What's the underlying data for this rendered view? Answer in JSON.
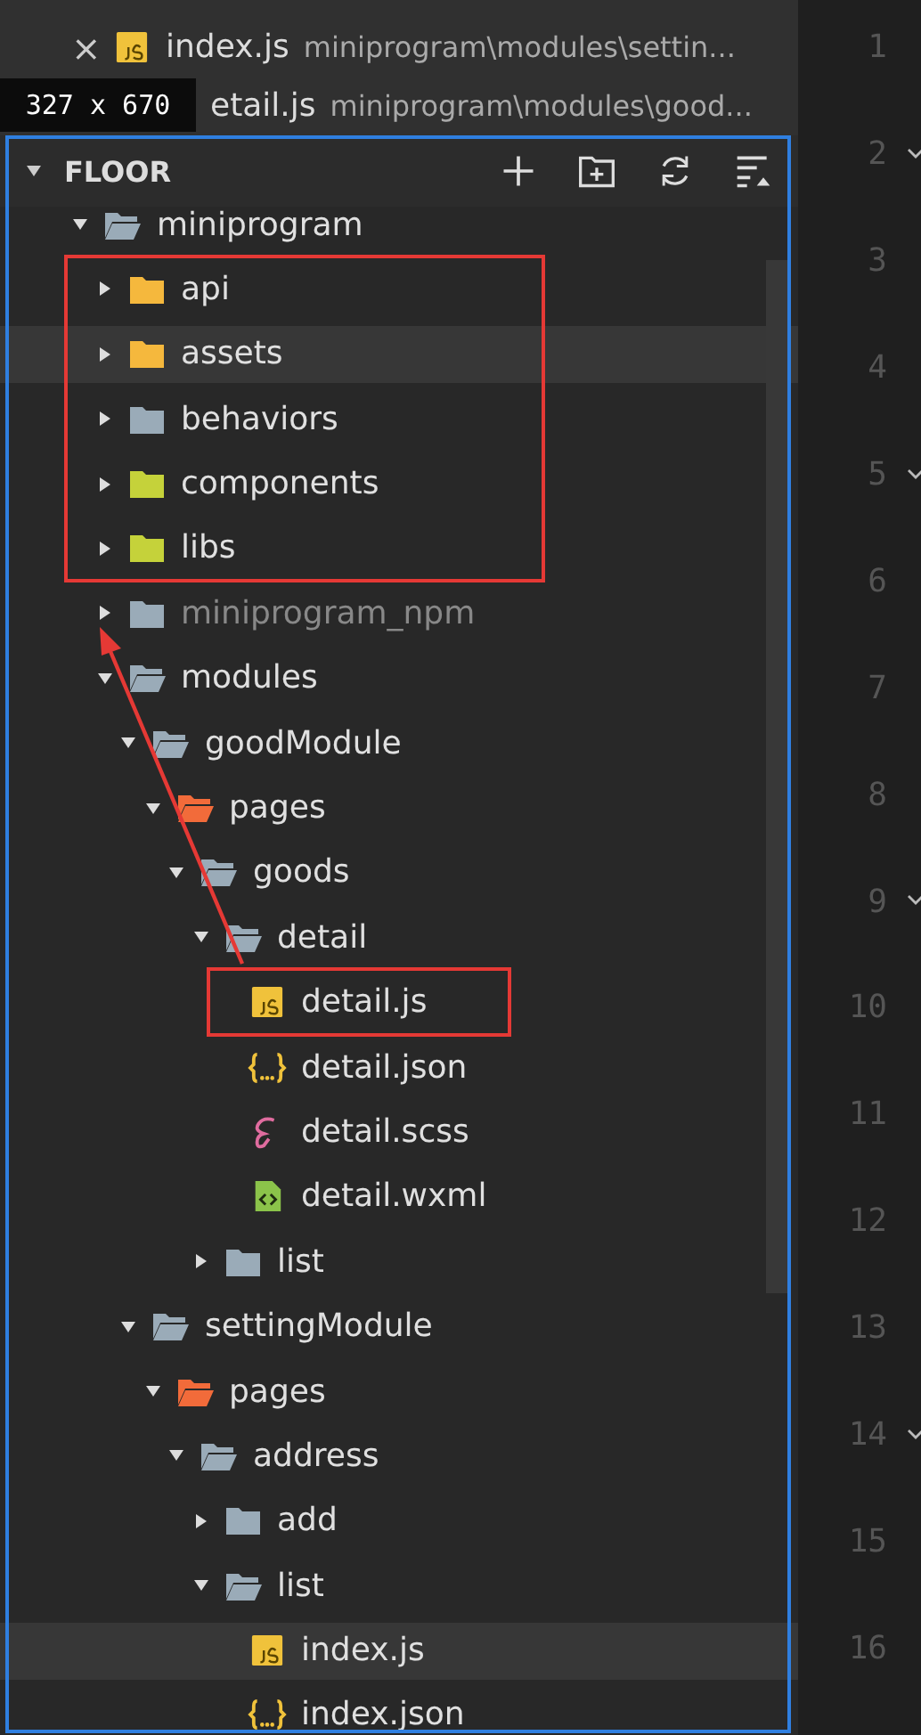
{
  "open_editors": [
    {
      "close": "×",
      "kind": "js",
      "name": "index.js",
      "path": "miniprogram\\modules\\settin..."
    },
    {
      "name": "etail.js",
      "path": "miniprogram\\modules\\good..."
    }
  ],
  "dimension_label": "327 x 670",
  "explorer": {
    "title": "FLOOR",
    "expanded": true
  },
  "tree": [
    {
      "kind": "folder",
      "name": "miniprogram",
      "color": "#9aabb8",
      "expanded": true,
      "highlighted": false,
      "dimmed": false,
      "children": [
        {
          "kind": "folder",
          "name": "api",
          "color": "#f5b83d",
          "expanded": false,
          "highlighted": false,
          "dimmed": false
        },
        {
          "kind": "folder",
          "name": "assets",
          "color": "#f5b83d",
          "expanded": false,
          "highlighted": true,
          "dimmed": false
        },
        {
          "kind": "folder",
          "name": "behaviors",
          "color": "#9aabb8",
          "expanded": false,
          "highlighted": false,
          "dimmed": false
        },
        {
          "kind": "folder",
          "name": "components",
          "color": "#c5d23a",
          "expanded": false,
          "highlighted": false,
          "dimmed": false
        },
        {
          "kind": "folder",
          "name": "libs",
          "color": "#c5d23a",
          "expanded": false,
          "highlighted": false,
          "dimmed": false
        },
        {
          "kind": "folder",
          "name": "miniprogram_npm",
          "color": "#9aabb8",
          "expanded": false,
          "highlighted": false,
          "dimmed": true
        },
        {
          "kind": "folder",
          "name": "modules",
          "color": "#9aabb8",
          "expanded": true,
          "highlighted": false,
          "dimmed": false,
          "children": [
            {
              "kind": "folder",
              "name": "goodModule",
              "color": "#9aabb8",
              "expanded": true,
              "highlighted": false,
              "dimmed": false,
              "children": [
                {
                  "kind": "folder",
                  "name": "pages",
                  "color": "#f26b3a",
                  "expanded": true,
                  "highlighted": false,
                  "dimmed": false,
                  "children": [
                    {
                      "kind": "folder",
                      "name": "goods",
                      "color": "#9aabb8",
                      "expanded": true,
                      "highlighted": false,
                      "dimmed": false,
                      "children": [
                        {
                          "kind": "folder",
                          "name": "detail",
                          "color": "#9aabb8",
                          "expanded": true,
                          "highlighted": false,
                          "dimmed": false,
                          "children": [
                            {
                              "kind": "js",
                              "name": "detail.js",
                              "highlighted": false,
                              "dimmed": false
                            },
                            {
                              "kind": "json",
                              "name": "detail.json",
                              "highlighted": false,
                              "dimmed": false
                            },
                            {
                              "kind": "scss",
                              "name": "detail.scss",
                              "highlighted": false,
                              "dimmed": false
                            },
                            {
                              "kind": "wxml",
                              "name": "detail.wxml",
                              "highlighted": false,
                              "dimmed": false
                            }
                          ]
                        },
                        {
                          "kind": "folder",
                          "name": "list",
                          "color": "#9aabb8",
                          "expanded": false,
                          "highlighted": false,
                          "dimmed": false
                        }
                      ]
                    }
                  ]
                }
              ]
            },
            {
              "kind": "folder",
              "name": "settingModule",
              "color": "#9aabb8",
              "expanded": true,
              "highlighted": false,
              "dimmed": false,
              "children": [
                {
                  "kind": "folder",
                  "name": "pages",
                  "color": "#f26b3a",
                  "expanded": true,
                  "highlighted": false,
                  "dimmed": false,
                  "children": [
                    {
                      "kind": "folder",
                      "name": "address",
                      "color": "#9aabb8",
                      "expanded": true,
                      "highlighted": false,
                      "dimmed": false,
                      "children": [
                        {
                          "kind": "folder",
                          "name": "add",
                          "color": "#9aabb8",
                          "expanded": false,
                          "highlighted": false,
                          "dimmed": false
                        },
                        {
                          "kind": "folder",
                          "name": "list",
                          "color": "#9aabb8",
                          "expanded": true,
                          "highlighted": false,
                          "dimmed": false,
                          "children": [
                            {
                              "kind": "js",
                              "name": "index.js",
                              "highlighted": true,
                              "dimmed": false
                            },
                            {
                              "kind": "json",
                              "name": "index.json",
                              "highlighted": false,
                              "dimmed": false
                            }
                          ]
                        }
                      ]
                    }
                  ]
                }
              ]
            }
          ]
        }
      ]
    }
  ],
  "line_numbers": [
    {
      "number": "1",
      "fold": false
    },
    {
      "number": "2",
      "fold": true
    },
    {
      "number": "3",
      "fold": false
    },
    {
      "number": "4",
      "fold": false
    },
    {
      "number": "5",
      "fold": true
    },
    {
      "number": "6",
      "fold": false
    },
    {
      "number": "7",
      "fold": false
    },
    {
      "number": "8",
      "fold": false
    },
    {
      "number": "9",
      "fold": true
    },
    {
      "number": "10",
      "fold": false
    },
    {
      "number": "11",
      "fold": false
    },
    {
      "number": "12",
      "fold": false
    },
    {
      "number": "13",
      "fold": false
    },
    {
      "number": "14",
      "fold": true
    },
    {
      "number": "15",
      "fold": false
    },
    {
      "number": "16",
      "fold": false
    }
  ]
}
